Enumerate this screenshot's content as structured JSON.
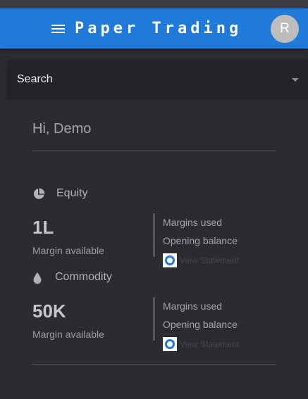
{
  "header": {
    "title": "Paper Trading",
    "avatar_initial": "R"
  },
  "search": {
    "label": "Search"
  },
  "greeting": "Hi, Demo",
  "segments": [
    {
      "name": "Equity",
      "icon": "pie-chart-icon",
      "margin_value": "1L",
      "margin_label": "Margin available",
      "margins_used_label": "Margins used",
      "opening_balance_label": "Opening balance",
      "view_statement_label": "View Statement"
    },
    {
      "name": "Commodity",
      "icon": "drop-icon",
      "margin_value": "50K",
      "margin_label": "Margin available",
      "margins_used_label": "Margins used",
      "opening_balance_label": "Opening balance",
      "view_statement_label": "View Statement"
    }
  ],
  "colors": {
    "accent": "#1f7ad9",
    "background": "#2a2c31",
    "avatar": "#bdbdbd"
  }
}
